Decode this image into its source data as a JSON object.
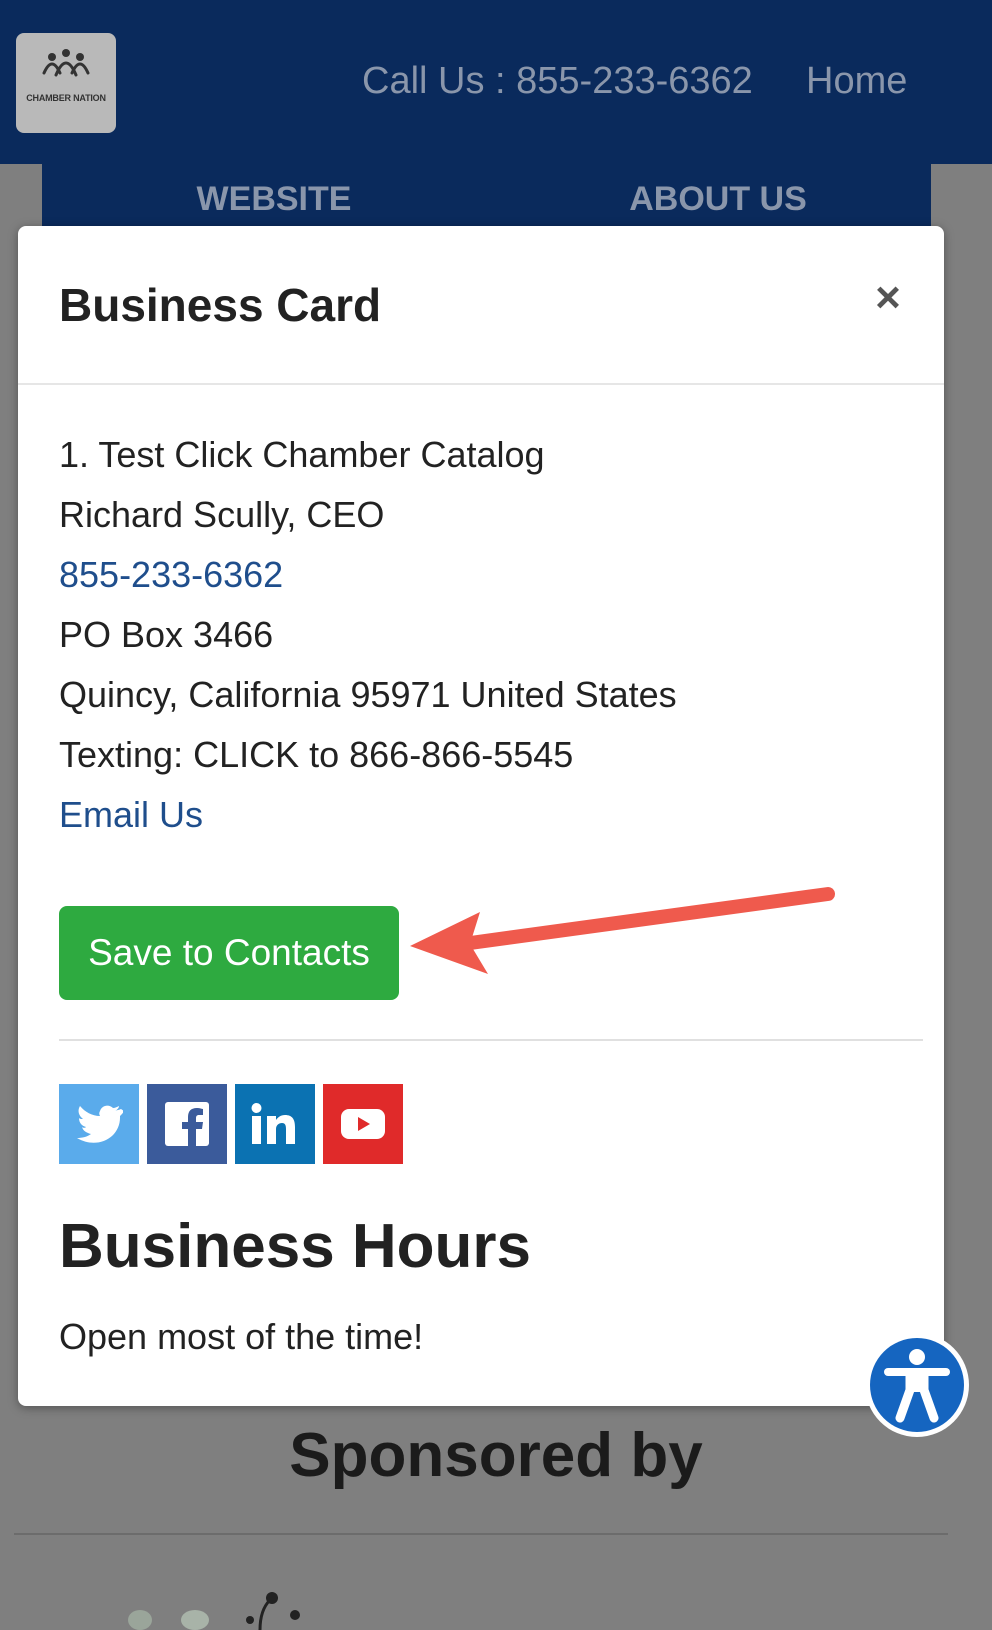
{
  "header": {
    "logo_text": "CHAMBER NATION",
    "call_label": "Call Us : 855-233-6362",
    "home_label": "Home"
  },
  "tabs": [
    "WEBSITE",
    "ABOUT US"
  ],
  "modal": {
    "title": "Business Card",
    "close_symbol": "×",
    "lines": {
      "business": "1. Test Click Chamber Catalog",
      "contact": "Richard Scully, CEO",
      "phone": "855-233-6362",
      "address1": "PO Box 3466",
      "address2": "Quincy, California 95971 United States",
      "texting": "Texting: CLICK to 866-866-5545",
      "email": "Email Us"
    },
    "save_button": "Save to Contacts",
    "social": [
      "twitter-icon",
      "facebook-icon",
      "linkedin-icon",
      "youtube-icon"
    ],
    "hours_title": "Business Hours",
    "hours_text": "Open most of the time!"
  },
  "sponsored_title": "Sponsored by",
  "colors": {
    "header_bg": "#0a2a5c",
    "save_button": "#2eaa40",
    "link": "#1f4e8c",
    "annotation_arrow": "#ef5a4d",
    "twitter": "#5aabeb",
    "facebook": "#3b5b9b",
    "linkedin": "#0b72b2",
    "youtube": "#e02a2a",
    "accessibility": "#1565c0"
  }
}
